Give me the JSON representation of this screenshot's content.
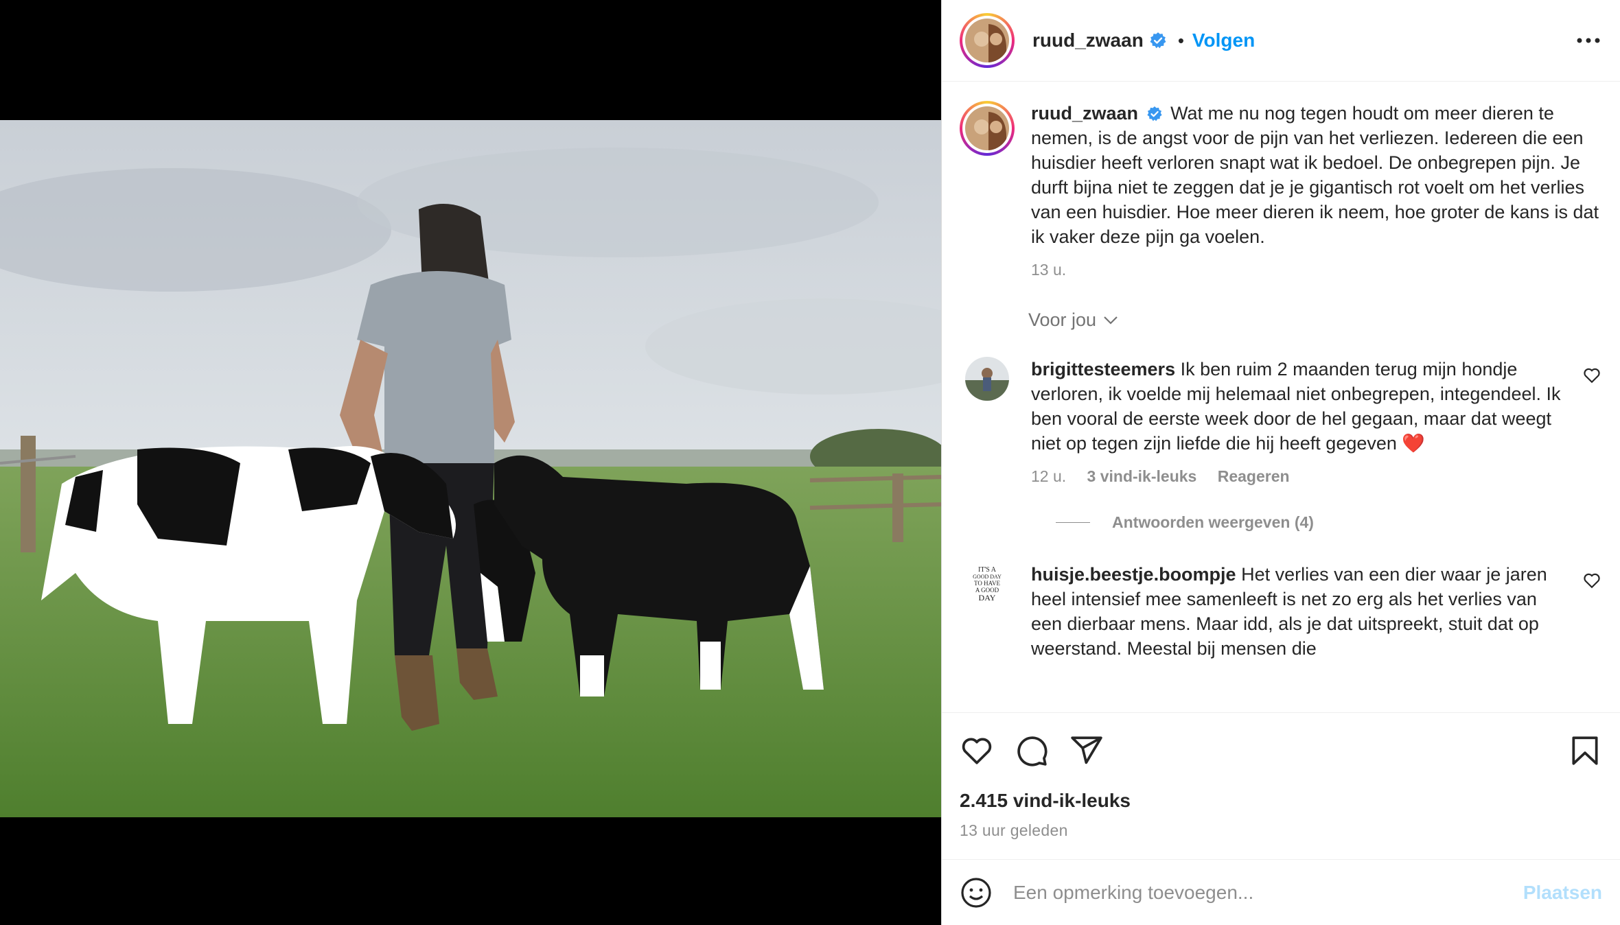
{
  "post": {
    "username": "ruud_zwaan",
    "follow_label": "Volgen",
    "dot": "•",
    "caption": "Wat me nu nog tegen houdt om meer dieren te nemen, is de angst voor de pijn van het verliezen. Iedereen die een huisdier heeft verloren snapt wat ik bedoel. De onbegrepen pijn. Je durft bijna niet te zeggen dat je je gigantisch rot voelt om het verlies van een huisdier. Hoe meer dieren ik neem, hoe groter de kans is dat ik vaker deze pijn ga voelen.",
    "caption_time": "13 u.",
    "likes": "2.415 vind-ik-leuks",
    "posted_ago": "13 uur geleden"
  },
  "filter": {
    "label": "Voor jou"
  },
  "comments": [
    {
      "username": "brigittesteemers",
      "text": "Ik ben ruim 2 maanden terug mijn hondje verloren, ik voelde mij helemaal niet onbegrepen, integendeel. Ik ben vooral de eerste week door de hel gegaan, maar dat weegt niet op tegen zijn liefde die hij heeft gegeven ❤️",
      "time": "12 u.",
      "likes": "3 vind-ik-leuks",
      "reply": "Reageren",
      "view_replies": "Antwoorden weergeven (4)"
    },
    {
      "username": "huisje.beestje.boompje",
      "text": "Het verlies van een dier waar je jaren heel intensief mee samenleeft is net zo erg als het verlies van een dierbaar mens. Maar idd, als je dat uitspreekt, stuit dat op weerstand. Meestal bij mensen die",
      "avatar_text": [
        "IT'S A",
        "GOOD DAY",
        "TO HAVE",
        "A GOOD",
        "DAY"
      ]
    }
  ],
  "composer": {
    "placeholder": "Een opmerking toevoegen...",
    "post_label": "Plaatsen"
  },
  "icons": {
    "verified": "verified-badge-icon",
    "more": "more-options-icon",
    "like": "heart-icon",
    "comment": "comment-icon",
    "share": "share-icon",
    "save": "bookmark-icon",
    "emoji": "emoji-icon",
    "chevron": "chevron-down-icon"
  },
  "colors": {
    "accent": "#0095f6",
    "verified": "#3897f0",
    "muted": "#8e8e8e",
    "post_disabled": "#b2dffc"
  }
}
